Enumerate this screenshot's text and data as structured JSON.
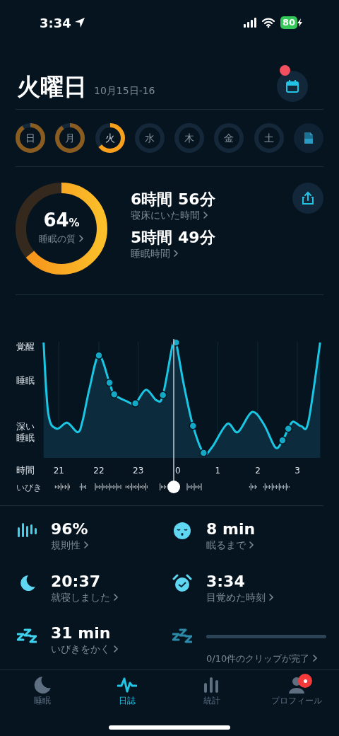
{
  "status_bar": {
    "time": "3:34",
    "battery": "80"
  },
  "header": {
    "title": "火曜日",
    "date": "10月15日-16",
    "calendar_badge": true
  },
  "days": [
    {
      "label": "日",
      "level": 0.9,
      "selected": false
    },
    {
      "label": "月",
      "level": 0.9,
      "selected": false
    },
    {
      "label": "火",
      "level": 0.64,
      "selected": true
    },
    {
      "label": "水",
      "selected": false
    },
    {
      "label": "木",
      "selected": false
    },
    {
      "label": "金",
      "selected": false
    },
    {
      "label": "土",
      "selected": false
    }
  ],
  "summary": {
    "quality": "64",
    "unit": "%",
    "quality_label": "睡眠の質",
    "level": 0.64,
    "stats": [
      {
        "value": "6時間 56分",
        "label": "寝床にいた時間"
      },
      {
        "value": "5時間 49分",
        "label": "睡眠時間"
      }
    ]
  },
  "chart": {
    "y_labels": [
      "覚醒",
      "睡眠",
      "深い睡眠"
    ],
    "time_label": "時間",
    "x_labels": [
      "21",
      "22",
      "23",
      "0",
      "1",
      "2",
      "3"
    ],
    "snore_label": "いびき"
  },
  "metrics": [
    {
      "kind": "value",
      "value": "96%",
      "label": "規則性"
    },
    {
      "kind": "value",
      "value": "8 min",
      "label": "眠るまで"
    },
    {
      "kind": "value",
      "value": "20:37",
      "label": "就寝しました"
    },
    {
      "kind": "value",
      "value": "3:34",
      "label": "目覚めた時刻"
    },
    {
      "kind": "value",
      "value": "31 min",
      "label": "いびきをかく"
    },
    {
      "kind": "progress",
      "label": "0/10件のクリップが完了"
    }
  ],
  "tabs": [
    {
      "label": "睡眠",
      "selected": false,
      "badge": false
    },
    {
      "label": "日誌",
      "selected": true,
      "badge": false
    },
    {
      "label": "統計",
      "selected": false,
      "badge": false
    },
    {
      "label": "プロフィール",
      "selected": false,
      "badge": true
    }
  ]
}
